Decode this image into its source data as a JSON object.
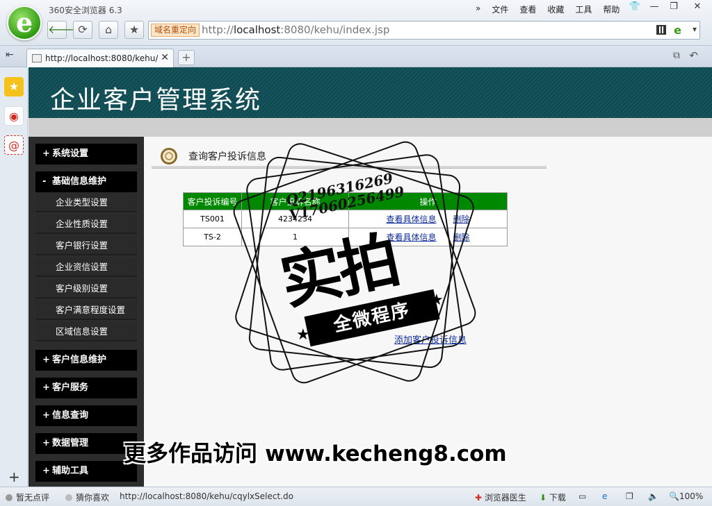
{
  "browser": {
    "app_title": "360安全浏览器 6.3",
    "menu": [
      "文件",
      "查看",
      "收藏",
      "工具",
      "帮助"
    ],
    "redirect_tag": "域名重定向",
    "url_prefix": "http://",
    "url_host": "localhost",
    "url_rest": ":8080/kehu/index.jsp",
    "tab_title": "http://localhost:8080/kehu/i",
    "icons": {
      "back": "back-arrow-icon",
      "refresh": "refresh-icon",
      "home": "home-icon",
      "favorite": "star-icon"
    }
  },
  "page": {
    "system_title": "企业客户管理系统",
    "nav": {
      "sections": [
        {
          "label": "系统设置",
          "sign": "+"
        },
        {
          "label": "基础信息维护",
          "sign": "-"
        },
        {
          "label": "客户信息维护",
          "sign": "+"
        },
        {
          "label": "客户服务",
          "sign": "+"
        },
        {
          "label": "信息查询",
          "sign": "+"
        },
        {
          "label": "数据管理",
          "sign": "+"
        },
        {
          "label": "辅助工具",
          "sign": "+"
        }
      ],
      "subitems": [
        "企业类型设置",
        "企业性质设置",
        "客户银行设置",
        "企业资信设置",
        "客户级别设置",
        "客户满意程度设置",
        "区域信息设置"
      ]
    },
    "content": {
      "breadcrumb": "查询客户投诉信息",
      "table": {
        "headers": [
          "客户投诉编号",
          "客户投诉名称",
          "操作"
        ],
        "rows": [
          {
            "id": "TS001",
            "name": "4234234",
            "view": "查看具体信息",
            "delete": "删除"
          },
          {
            "id": "TS-2",
            "name": "1",
            "view": "查看具体信息",
            "delete": "删除"
          }
        ]
      },
      "add_link": "添加客户投诉信息"
    }
  },
  "watermark": {
    "qq": "Q2196316269",
    "vx": "V17060256499",
    "main": "实拍",
    "ribbon": "全微程序",
    "promo_text": "更多作品访问",
    "promo_url": "www.kecheng8.com"
  },
  "statusbar": {
    "rating": "暂无点评",
    "guess": "猜你喜欢",
    "hover_url": "http://localhost:8080/kehu/cqylxSelect.do",
    "doctor": "浏览器医生",
    "download": "下载",
    "zoom": "100%"
  }
}
